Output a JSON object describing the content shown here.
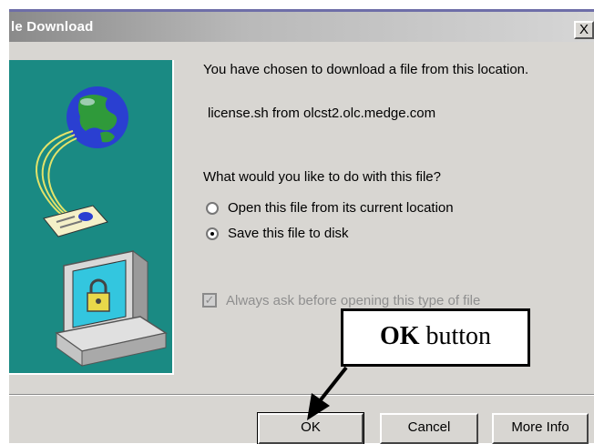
{
  "window": {
    "title": "le Download",
    "close_label": "X"
  },
  "main": {
    "message": "You have chosen to download a file from this location.",
    "file_source": "license.sh from olcst2.olc.medge.com",
    "question": "What would you like to do with this file?",
    "options": [
      {
        "label": "Open this file from its current location",
        "selected": false
      },
      {
        "label": "Save this file to disk",
        "selected": true
      }
    ],
    "always_ask": {
      "label": "Always ask before opening this type of file",
      "checked": true,
      "enabled": false
    }
  },
  "buttons": {
    "ok": "OK",
    "cancel": "Cancel",
    "more_info": "More Info"
  },
  "annotation": {
    "bold": "OK",
    "rest": " button"
  },
  "colors": {
    "side_panel": "#1a8a83",
    "dialog_bg": "#d8d6d2"
  },
  "icons": [
    "globe-icon",
    "document-icon",
    "computer-icon",
    "padlock-icon",
    "arrow-icon"
  ]
}
